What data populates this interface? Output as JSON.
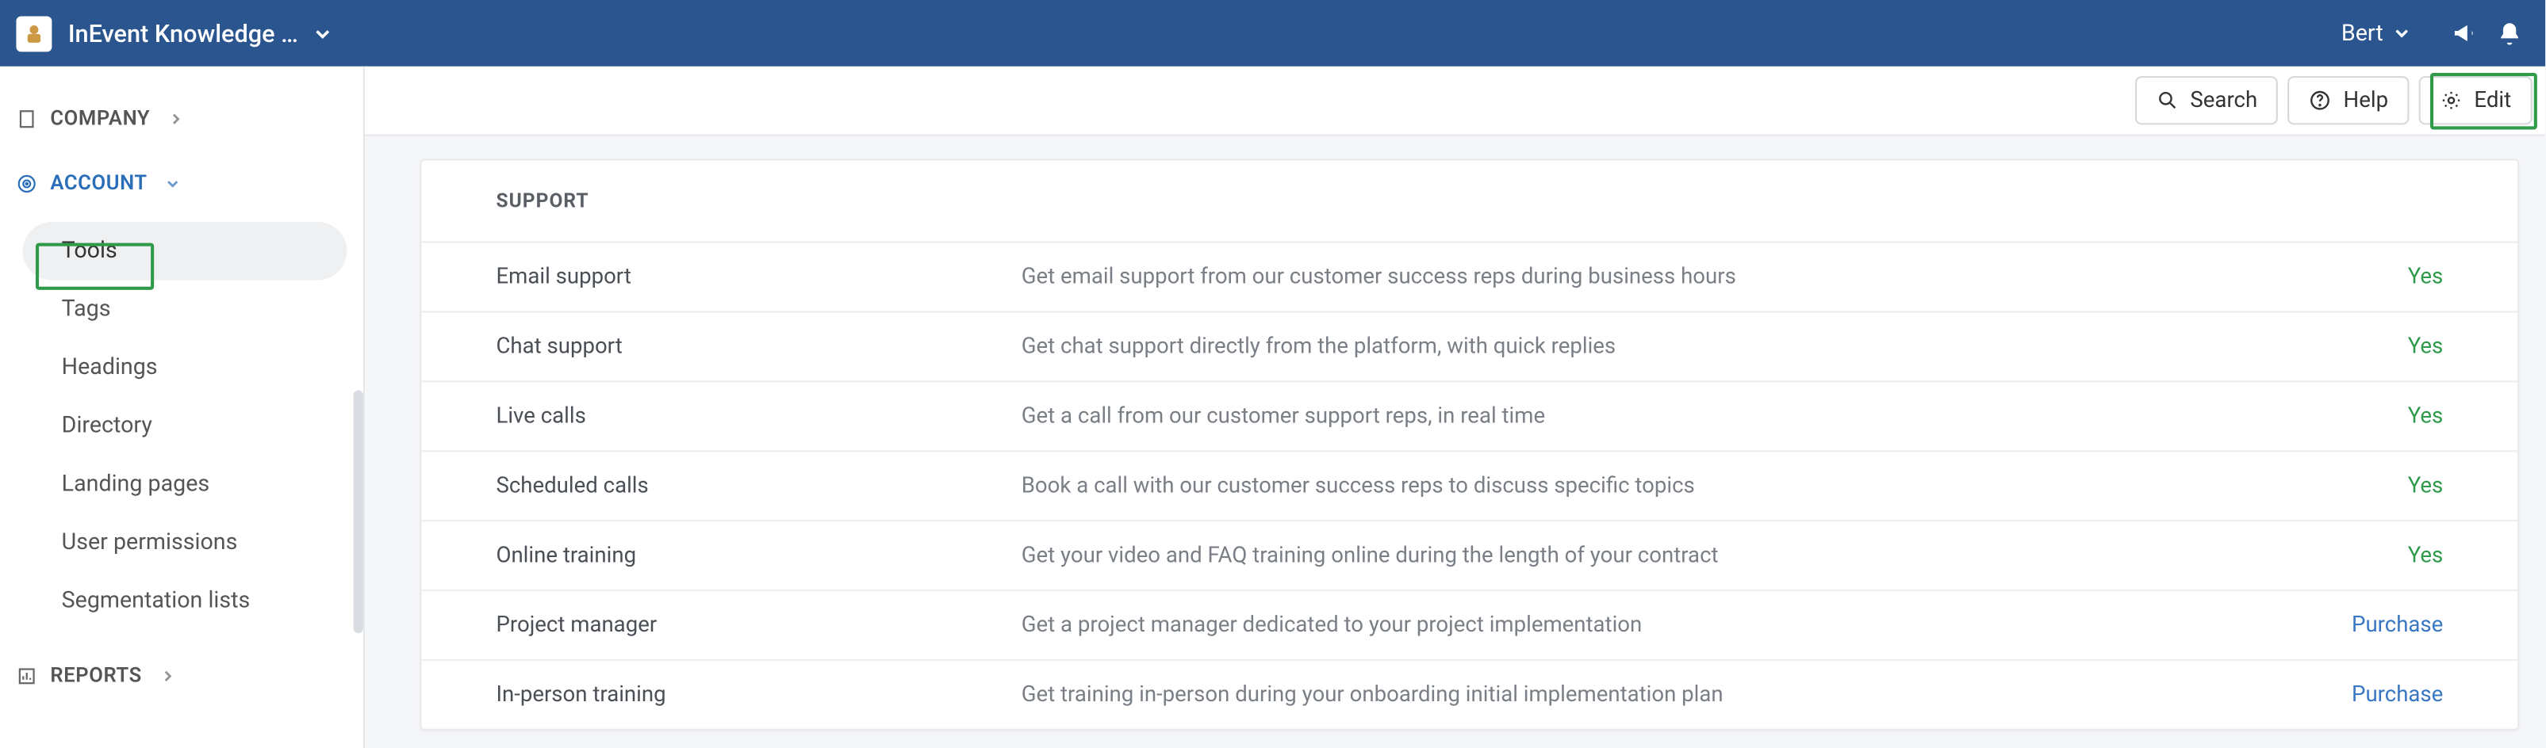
{
  "topbar": {
    "title": "InEvent Knowledge …",
    "user": "Bert"
  },
  "sidebar": {
    "company_label": "COMPANY",
    "account_label": "ACCOUNT",
    "reports_label": "REPORTS",
    "items": [
      {
        "label": "Tools",
        "active": true
      },
      {
        "label": "Tags"
      },
      {
        "label": "Headings"
      },
      {
        "label": "Directory"
      },
      {
        "label": "Landing pages"
      },
      {
        "label": "User permissions"
      },
      {
        "label": "Segmentation lists"
      }
    ]
  },
  "toolbar": {
    "search": "Search",
    "help": "Help",
    "edit": "Edit"
  },
  "card": {
    "title": "SUPPORT",
    "rows": [
      {
        "name": "Email support",
        "desc": "Get email support from our customer success reps during business hours",
        "status": "Yes",
        "kind": "yes"
      },
      {
        "name": "Chat support",
        "desc": "Get chat support directly from the platform, with quick replies",
        "status": "Yes",
        "kind": "yes"
      },
      {
        "name": "Live calls",
        "desc": "Get a call from our customer support reps, in real time",
        "status": "Yes",
        "kind": "yes"
      },
      {
        "name": "Scheduled calls",
        "desc": "Book a call with our customer success reps to discuss specific topics",
        "status": "Yes",
        "kind": "yes"
      },
      {
        "name": "Online training",
        "desc": "Get your video and FAQ training online during the length of your contract",
        "status": "Yes",
        "kind": "yes"
      },
      {
        "name": "Project manager",
        "desc": "Get a project manager dedicated to your project implementation",
        "status": "Purchase",
        "kind": "purchase"
      },
      {
        "name": "In-person training",
        "desc": "Get training in-person during your onboarding initial implementation plan",
        "status": "Purchase",
        "kind": "purchase"
      }
    ]
  }
}
